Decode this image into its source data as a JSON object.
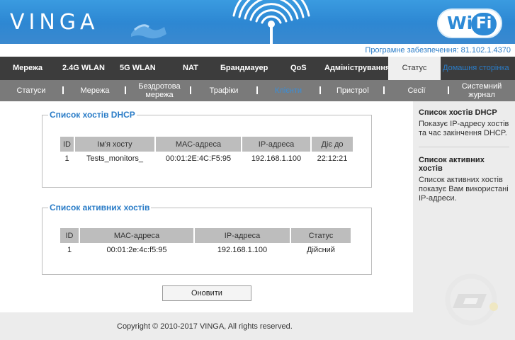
{
  "header": {
    "logo": "VINGA",
    "wifi_w": "Wi",
    "wifi_fi": "Fi"
  },
  "firmware": "Програмне забезпечення: 81.102.1.4370",
  "main_nav": [
    {
      "label": "Мережа"
    },
    {
      "label": "2.4G WLAN"
    },
    {
      "label": "5G WLAN"
    },
    {
      "label": "NAT"
    },
    {
      "label": "Брандмауер"
    },
    {
      "label": "QoS"
    },
    {
      "label": "Адміністрування"
    },
    {
      "label": "Статус",
      "active": true
    },
    {
      "label": "Домашня сторінка"
    }
  ],
  "sub_nav": [
    {
      "label": "Статуси"
    },
    {
      "label": "Мережа"
    },
    {
      "label": "Бездротова мережа"
    },
    {
      "label": "Трафіки"
    },
    {
      "label": "Клієнти",
      "active": true
    },
    {
      "label": "Пристрої"
    },
    {
      "label": "Сесії"
    },
    {
      "label": "Системний журнал"
    }
  ],
  "dhcp": {
    "title": "Список хостів DHCP",
    "columns": [
      "ID",
      "Ім'я хосту",
      "МАС-адреса",
      "IP-адреса",
      "Діє до"
    ],
    "rows": [
      [
        "1",
        "Tests_monitors_",
        "00:01:2E:4C:F5:95",
        "192.168.1.100",
        "22:12:21"
      ]
    ]
  },
  "active": {
    "title": "Список активних хостів",
    "columns": [
      "ID",
      "МАС-адреса",
      "IP-адреса",
      "Статус"
    ],
    "rows": [
      [
        "1",
        "00:01:2e:4c:f5:95",
        "192.168.1.100",
        "Дійсний"
      ]
    ]
  },
  "refresh_label": "Оновити",
  "sidebar": {
    "sections": [
      {
        "title": "Список хостів DHCP",
        "text": "Показує IP-адресу хостів та час закінчення DHCP."
      },
      {
        "title": "Список активних хостів",
        "text": "Список активних хостів показує Вам використані IP-адреси."
      }
    ]
  },
  "footer": {
    "copyright": "Copyright © 2010-2017 VINGA, All rights reserved."
  },
  "colors": {
    "header_blue": "#2c86d2",
    "nav_dark": "#3c3c3c",
    "subnav_grey": "#7a7a7a",
    "link_blue": "#2a7cc7"
  }
}
